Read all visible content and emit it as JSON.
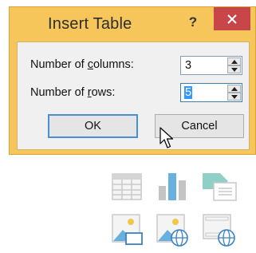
{
  "dialog": {
    "title": "Insert Table",
    "help_label": "?",
    "close_icon": "close-icon",
    "columns": {
      "label_pre": "Number of ",
      "label_mn": "c",
      "label_post": "olumns:",
      "value": "3"
    },
    "rows": {
      "label_pre": "Number of ",
      "label_mn": "r",
      "label_post": "ows:",
      "value": "5"
    },
    "ok_label": "OK",
    "cancel_label": "Cancel"
  },
  "ribbon_icons": [
    "table-icon",
    "chart-icon",
    "smartart-icon",
    "picture-icon",
    "online-picture-icon",
    "video-icon"
  ],
  "colors": {
    "dialog_frame": "#f6c65b",
    "close_button": "#c8454a",
    "icon_gray": "#c9c9c9",
    "icon_blue": "#6ab0de",
    "icon_teal": "#8fcfc6"
  }
}
